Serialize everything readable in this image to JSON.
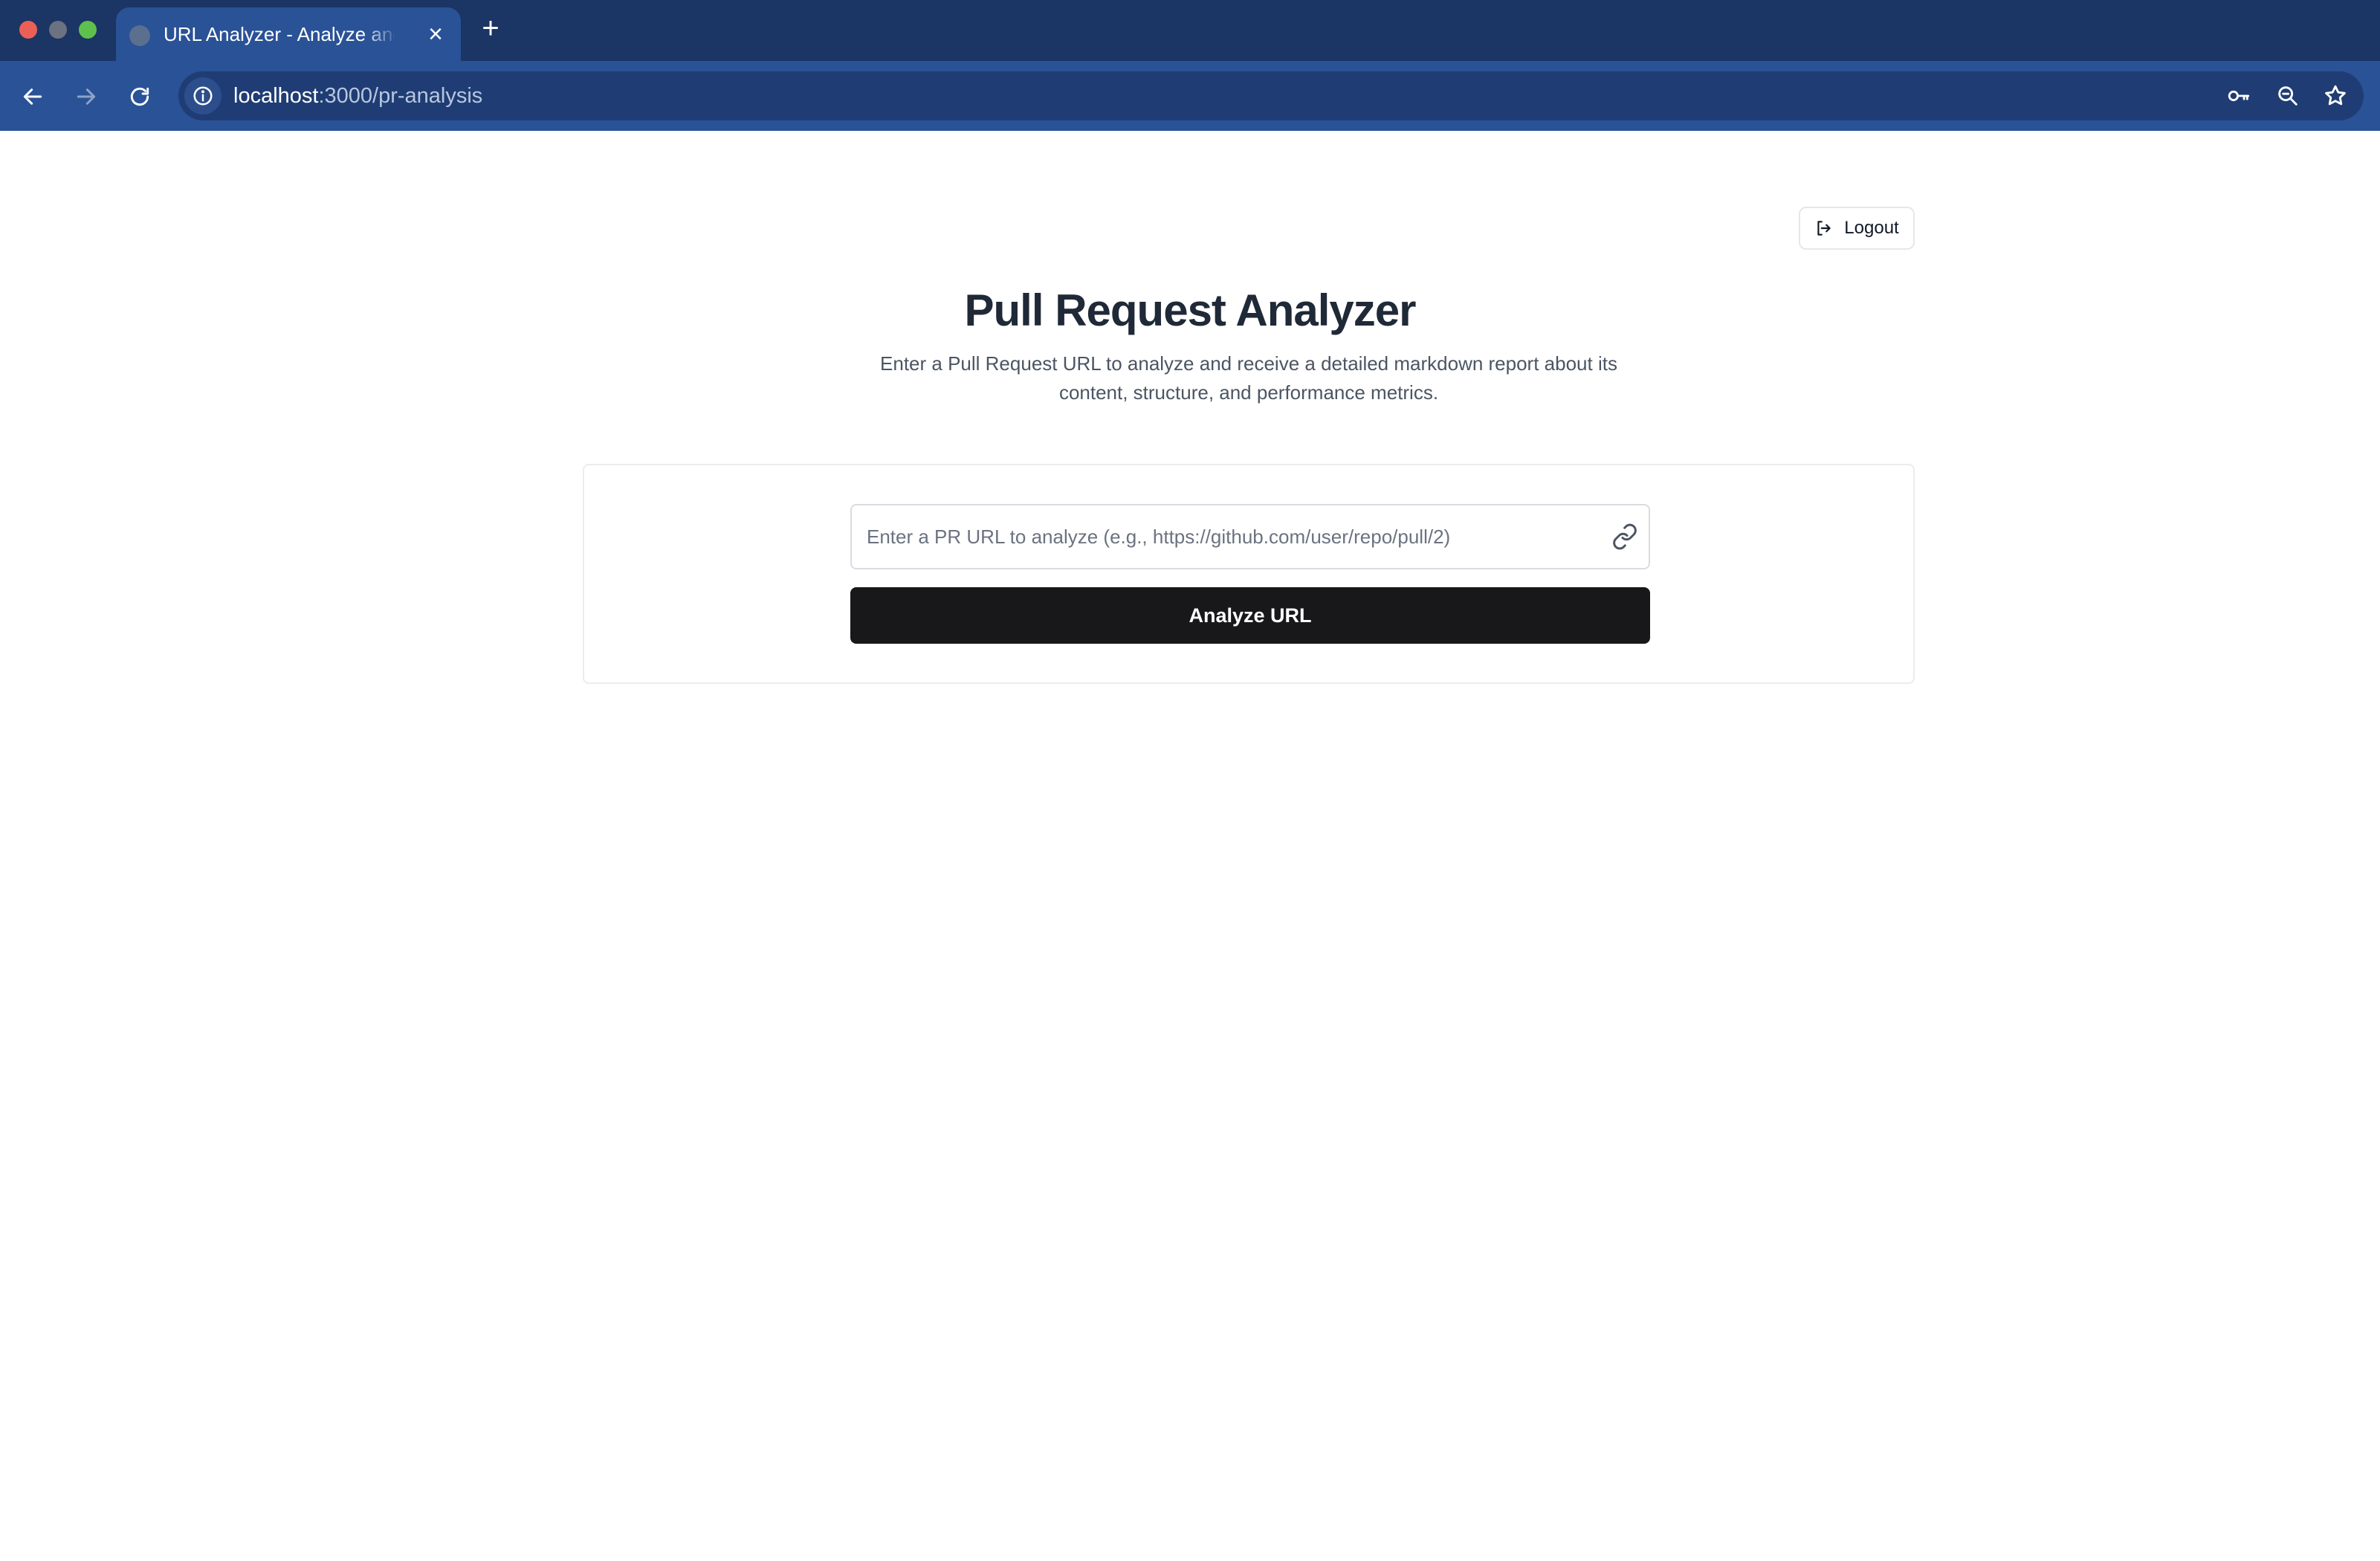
{
  "browser": {
    "tab": {
      "title": "URL Analyzer - Analyze and V",
      "close_glyph": "×",
      "favicon": "globe-icon"
    },
    "new_tab_glyph": "+",
    "address_bar": {
      "host": "localhost",
      "path": ":3000/pr-analysis"
    },
    "icons": [
      "back-arrow-icon",
      "forward-arrow-icon",
      "reload-icon",
      "info-icon",
      "key-icon",
      "zoom-icon",
      "star-icon"
    ]
  },
  "header": {
    "logout_label": "Logout"
  },
  "main": {
    "title": "Pull Request Analyzer",
    "subtitle": "Enter a Pull Request URL to analyze and receive a detailed markdown report about its content, structure, and performance metrics.",
    "url_input": {
      "value": "",
      "placeholder": "Enter a PR URL to analyze (e.g., https://github.com/user/repo/pull/2)"
    },
    "analyze_button_label": "Analyze URL"
  },
  "colors": {
    "tabstrip": "#1b3564",
    "toolbar": "#2a5296",
    "primary_button": "#18181b",
    "title_text": "#1f2937"
  }
}
